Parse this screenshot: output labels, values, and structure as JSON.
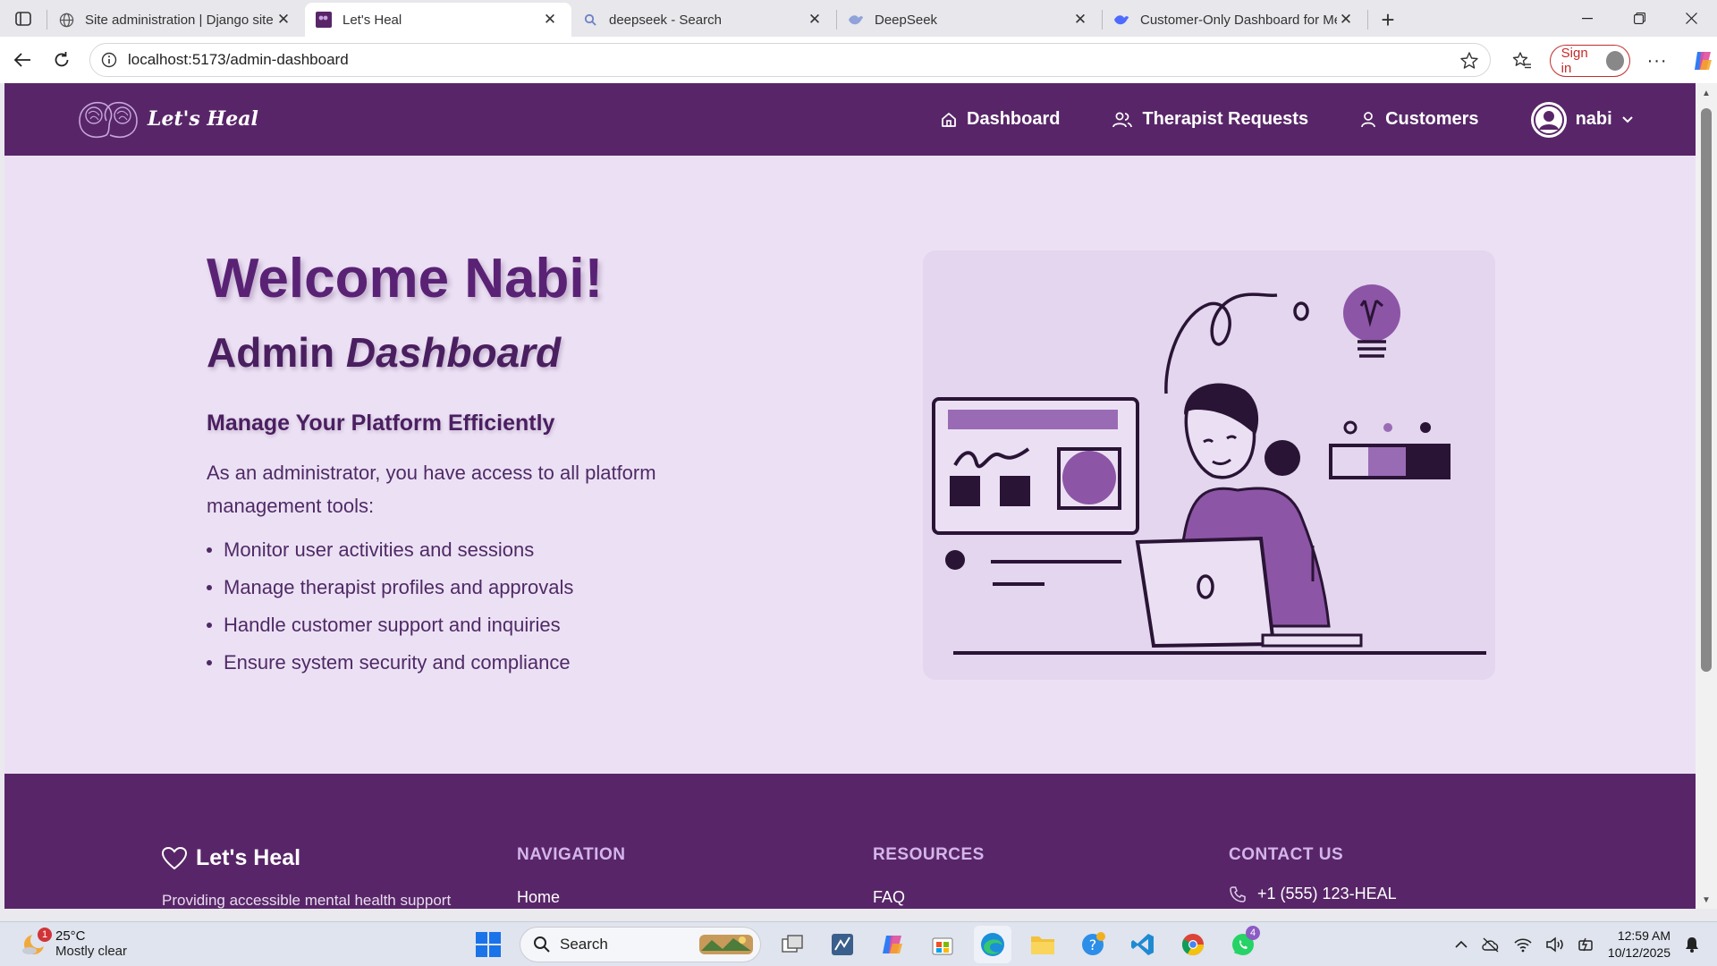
{
  "browser": {
    "tabs": [
      {
        "title": "Site administration | Django site a",
        "icon": "globe-icon",
        "active": false
      },
      {
        "title": "Let's Heal",
        "icon": "lets-heal-favicon",
        "active": true
      },
      {
        "title": "deepseek - Search",
        "icon": "search-icon",
        "active": false
      },
      {
        "title": "DeepSeek",
        "icon": "deepseek-icon",
        "active": false
      },
      {
        "title": "Customer-Only Dashboard for Me",
        "icon": "deepseek-icon",
        "active": false
      }
    ],
    "url": "localhost:5173/admin-dashboard",
    "signin_label": "Sign in"
  },
  "site": {
    "logo_text": "Let's Heal",
    "nav": {
      "dashboard": "Dashboard",
      "therapist_requests": "Therapist Requests",
      "customers": "Customers"
    },
    "user_name": "nabi"
  },
  "hero": {
    "welcome": "Welcome Nabi!",
    "subtitle_plain": "Admin",
    "subtitle_em": "Dashboard",
    "heading": "Manage Your Platform Efficiently",
    "intro": "As an administrator, you have access to all platform management tools:",
    "bullets": [
      "Monitor user activities and sessions",
      "Manage therapist profiles and approvals",
      "Handle customer support and inquiries",
      "Ensure system security and compliance"
    ]
  },
  "footer": {
    "brand": "Let's Heal",
    "description": "Providing accessible mental health support",
    "navigation_heading": "NAVIGATION",
    "navigation_first": "Home",
    "resources_heading": "RESOURCES",
    "resources_first": "FAQ",
    "contact_heading": "CONTACT US",
    "contact_phone": "+1 (555) 123-HEAL"
  },
  "taskbar": {
    "weather_temp": "25°C",
    "weather_cond": "Mostly clear",
    "weather_badge": "1",
    "search_label": "Search",
    "whatsapp_badge": "4",
    "time": "12:59 AM",
    "date": "10/12/2025"
  },
  "colors": {
    "brand_purple": "#582668",
    "page_bg": "#ece1f4",
    "accent_light": "#d4b5ea"
  }
}
